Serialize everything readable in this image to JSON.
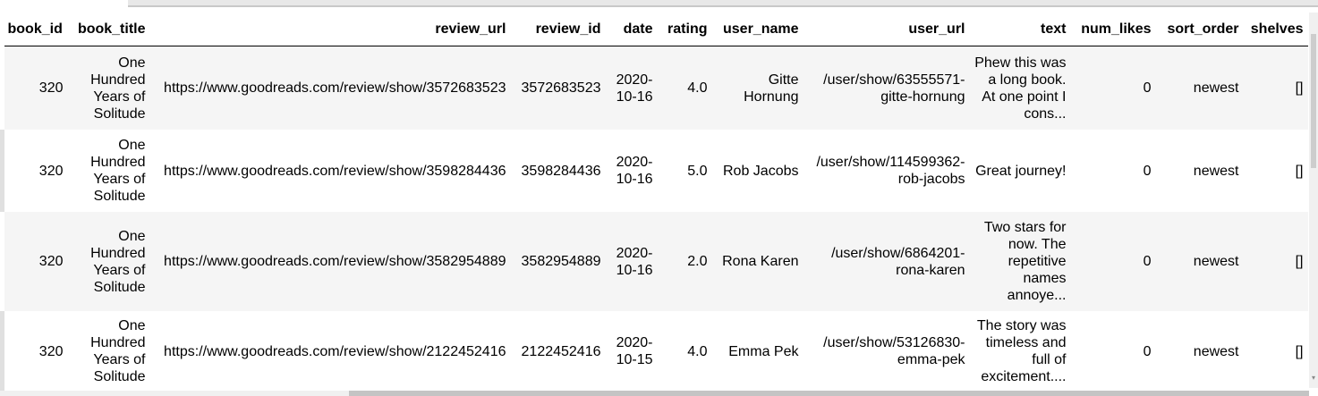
{
  "columns": [
    "book_id",
    "book_title",
    "review_url",
    "review_id",
    "date",
    "rating",
    "user_name",
    "user_url",
    "text",
    "num_likes",
    "sort_order",
    "shelves"
  ],
  "rows": [
    [
      "320",
      "One Hundred Years of Solitude",
      "https://www.goodreads.com/review/show/3572683523",
      "3572683523",
      "2020-10-16",
      "4.0",
      "Gitte Hornung",
      "/user/show/63555571-gitte-hornung",
      "Phew this was a long book. At one point I cons...",
      "0",
      "newest",
      "[]"
    ],
    [
      "320",
      "One Hundred Years of Solitude",
      "https://www.goodreads.com/review/show/3598284436",
      "3598284436",
      "2020-10-16",
      "5.0",
      "Rob Jacobs",
      "/user/show/114599362-rob-jacobs",
      "Great journey!",
      "0",
      "newest",
      "[]"
    ],
    [
      "320",
      "One Hundred Years of Solitude",
      "https://www.goodreads.com/review/show/3582954889",
      "3582954889",
      "2020-10-16",
      "2.0",
      "Rona Karen",
      "/user/show/6864201-rona-karen",
      "Two stars for now. The repetitive names annoye...",
      "0",
      "newest",
      "[]"
    ],
    [
      "320",
      "One Hundred Years of Solitude",
      "https://www.goodreads.com/review/show/2122452416",
      "2122452416",
      "2020-10-15",
      "4.0",
      "Emma Pek",
      "/user/show/53126830-emma-pek",
      "The story was timeless and full of excitement....",
      "0",
      "newest",
      "[]"
    ]
  ],
  "scrollbar_arrow_glyph": "▾"
}
